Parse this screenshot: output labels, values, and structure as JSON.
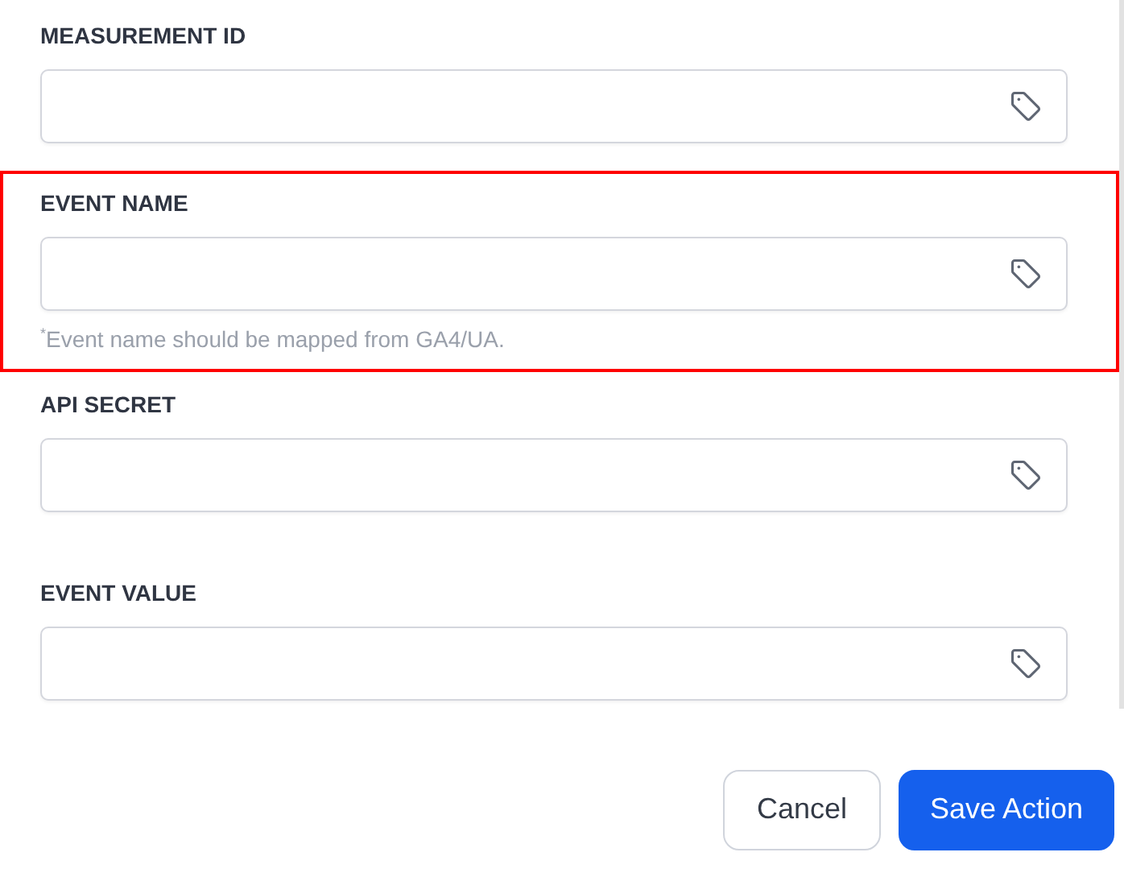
{
  "fields": [
    {
      "label": "MEASUREMENT ID",
      "highlighted": false
    },
    {
      "label": "EVENT NAME",
      "highlighted": true,
      "hint": "$^{*}$Event name should be mapped from GA4/UA."
    },
    {
      "label": "API SECRET",
      "highlighted": false
    },
    {
      "label": "EVENT VALUE",
      "highlighted": false
    }
  ],
  "buttons": [
    {
      "label": "Cancel",
      "kind": "secondary"
    },
    {
      "label": "Save Action",
      "kind": "primary"
    }
  ]
}
